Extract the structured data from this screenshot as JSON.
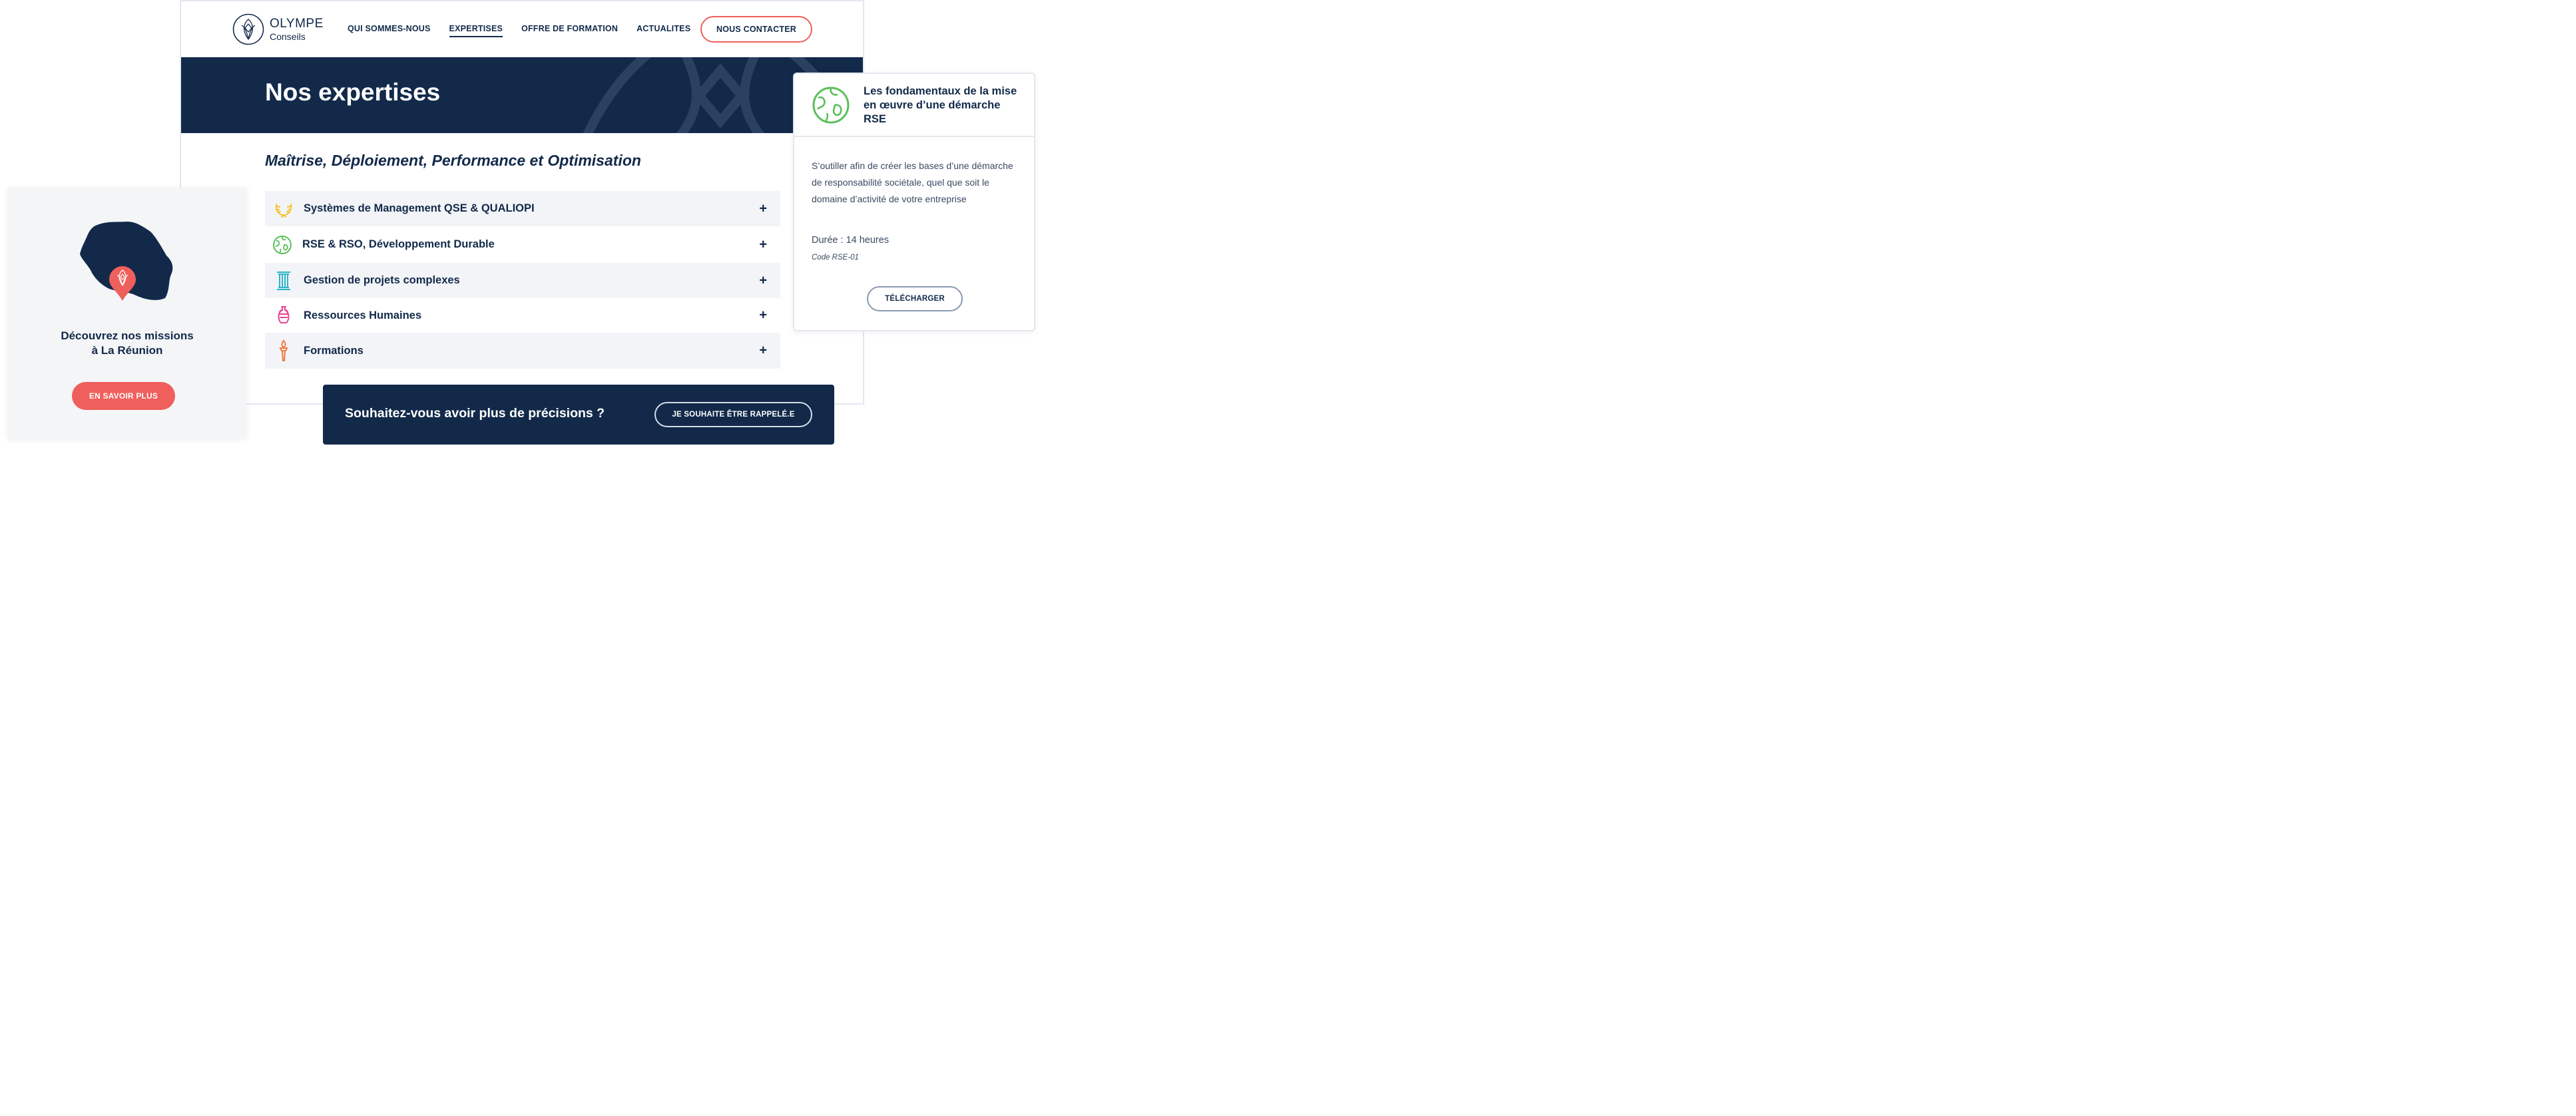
{
  "brand": {
    "name_line1": "OLYMPE",
    "name_line2": "Conseils"
  },
  "nav": {
    "items": [
      {
        "label": "QUI SOMMES-NOUS",
        "active": false
      },
      {
        "label": "EXPERTISES",
        "active": true
      },
      {
        "label": "OFFRE DE FORMATION",
        "active": false
      },
      {
        "label": "ACTUALITES",
        "active": false
      }
    ],
    "contact_label": "NOUS CONTACTER"
  },
  "hero": {
    "title": "Nos expertises"
  },
  "main": {
    "subtitle": "Maîtrise, Déploiement, Performance et Optimisation",
    "accordion": [
      {
        "label": "Systèmes de Management QSE & QUALIOPI",
        "icon": "laurel-icon",
        "icon_color": "#f5c22b"
      },
      {
        "label": "RSE & RSO, Développement Durable",
        "icon": "globe-icon",
        "icon_color": "#5bbf5a"
      },
      {
        "label": "Gestion de projets complexes",
        "icon": "column-icon",
        "icon_color": "#2bb5c9"
      },
      {
        "label": "Ressources Humaines",
        "icon": "amphora-icon",
        "icon_color": "#e84393"
      },
      {
        "label": "Formations",
        "icon": "torch-icon",
        "icon_color": "#f07a3e"
      }
    ],
    "expand_symbol": "+"
  },
  "left_card": {
    "title_line1": "Découvrez nos missions",
    "title_line2": "à La Réunion",
    "button_label": "EN SAVOIR PLUS"
  },
  "right_card": {
    "title": "Les fondamentaux de la mise en œuvre d’une démarche RSE",
    "description": "S’outiller afin de créer les bases d’une démarche de responsabilité sociétale, quel que soit le domaine d’activité de votre entreprise",
    "duration": "Durée : 14 heures",
    "code": "Code RSE-01",
    "button_label": "TÉLÉCHARGER"
  },
  "cta": {
    "text": "Souhaitez-vous avoir plus de précisions ?",
    "button_label": "JE SOUHAITE ÊTRE RAPPELÉ.E"
  },
  "colors": {
    "navy": "#12294a",
    "coral": "#ef5f5b",
    "light_gray": "#f2f4f7",
    "border": "#e3e8ef"
  }
}
